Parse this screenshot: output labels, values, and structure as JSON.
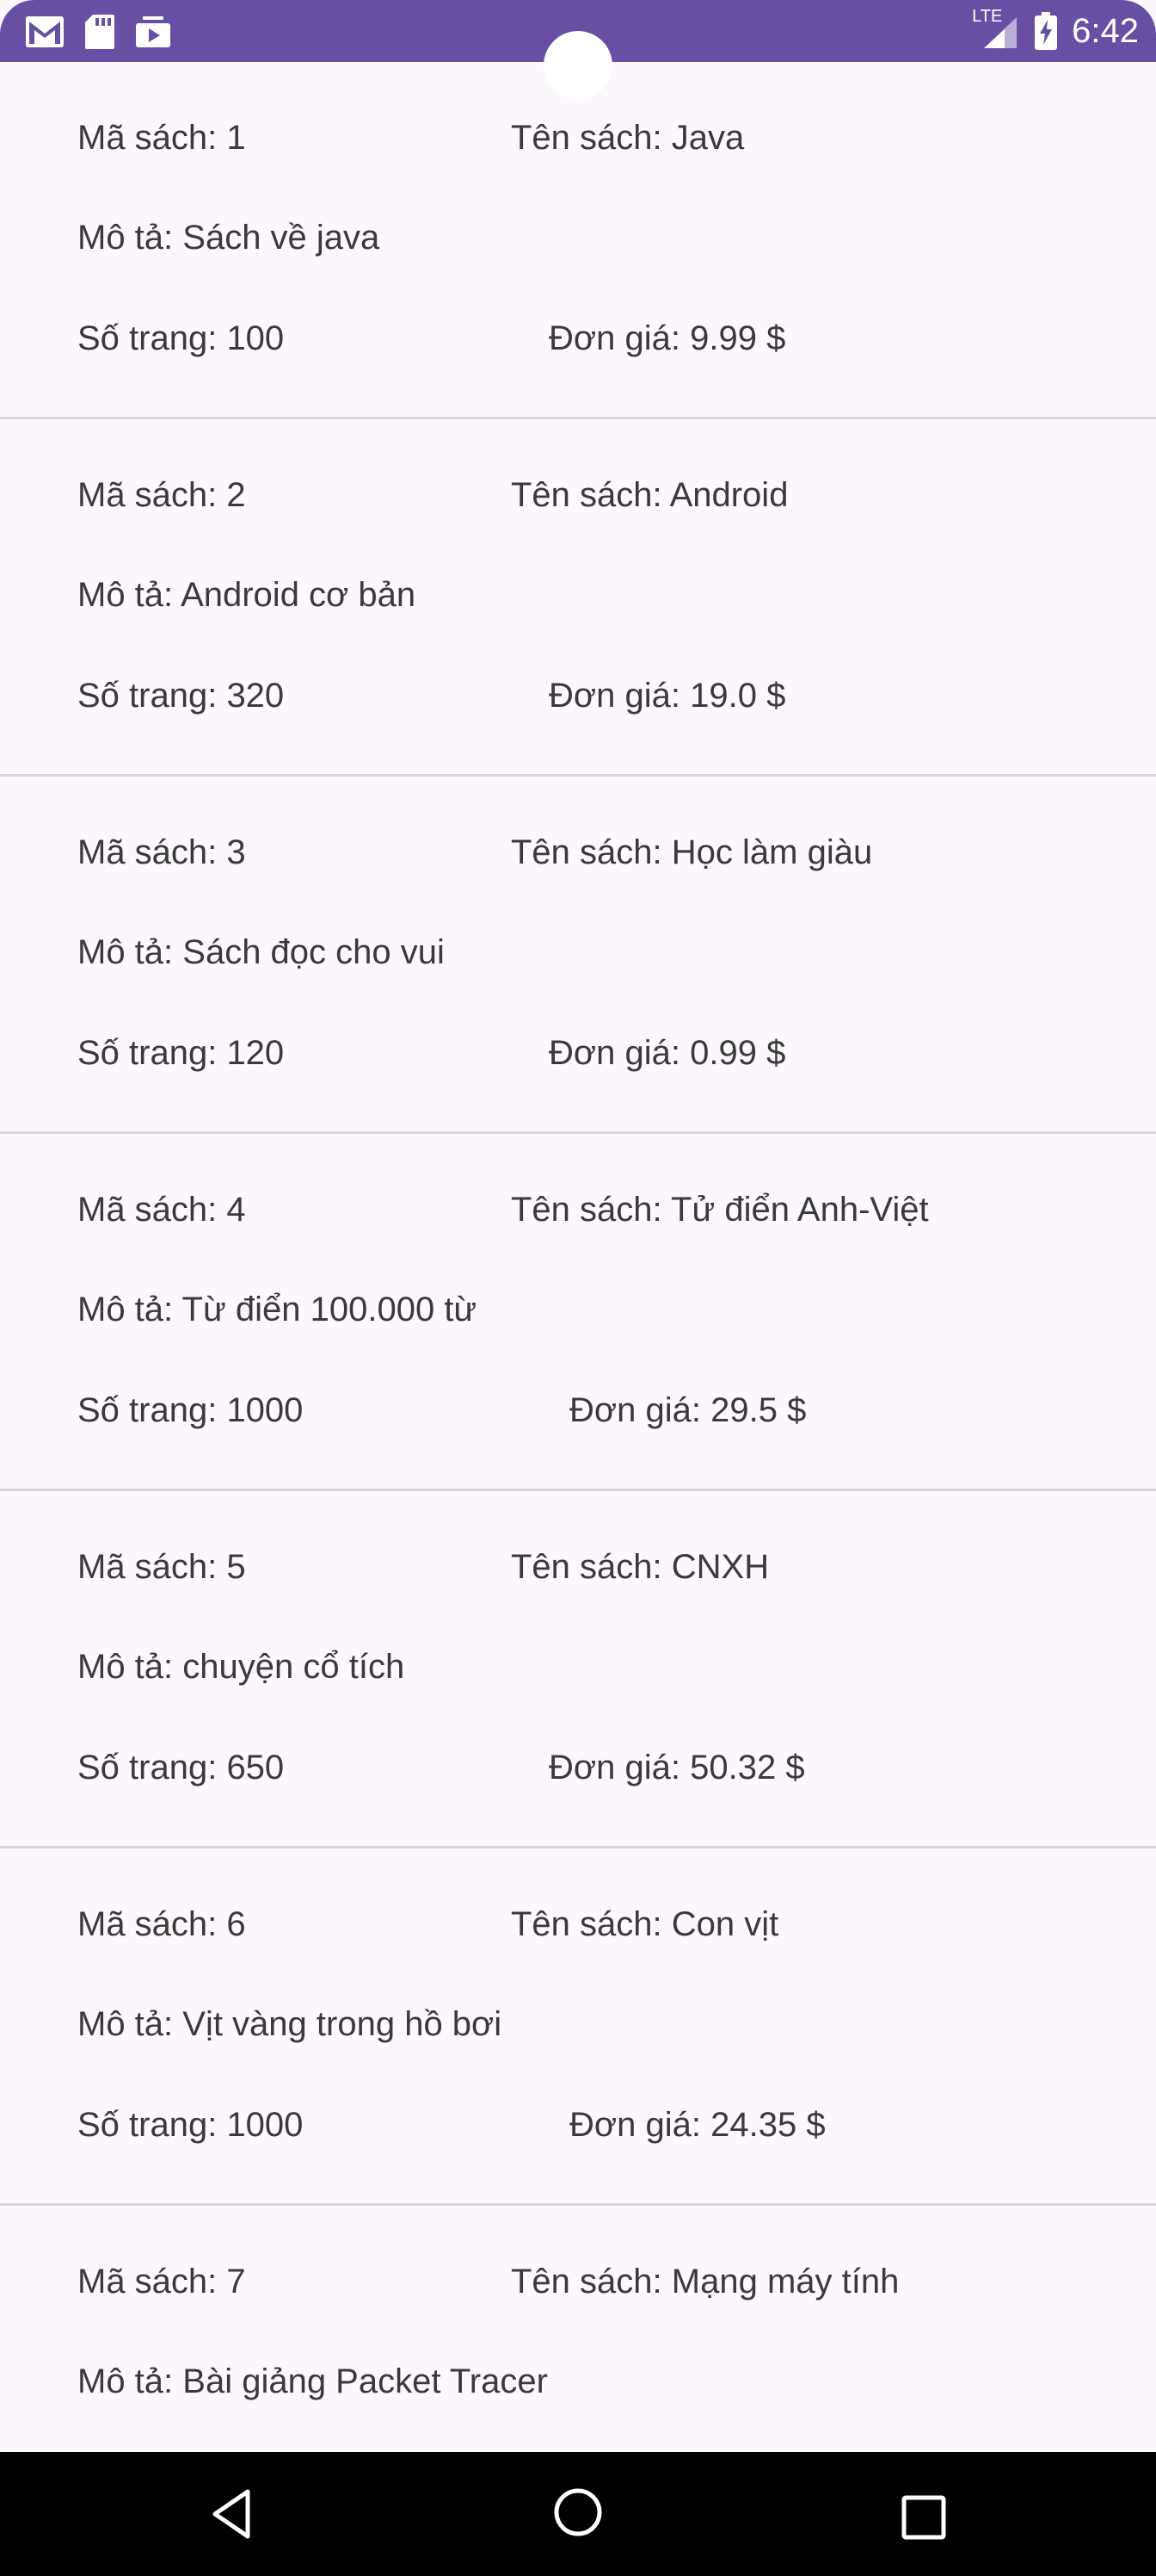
{
  "status_bar": {
    "time": "6:42",
    "network_label": "LTE",
    "left_icons": [
      "gmail-icon",
      "sd-card-icon",
      "media-icon"
    ],
    "background_color": "#6750a4"
  },
  "labels": {
    "id": "Mã sách: ",
    "name": "Tên sách: ",
    "description": "Mô tả: ",
    "pages": "Số trang: ",
    "price": "Đơn giá: ",
    "currency": " $"
  },
  "books": [
    {
      "id": "1",
      "name": "Java",
      "description": "Sách về java",
      "pages": "100",
      "price": "9.99"
    },
    {
      "id": "2",
      "name": "Android",
      "description": "Android cơ bản",
      "pages": "320",
      "price": "19.0"
    },
    {
      "id": "3",
      "name": "Học làm giàu",
      "description": "Sách đọc cho vui",
      "pages": "120",
      "price": "0.99"
    },
    {
      "id": "4",
      "name": "Tử điển Anh-Việt",
      "description": "Từ điển 100.000 từ",
      "pages": "1000",
      "price": "29.5"
    },
    {
      "id": "5",
      "name": "CNXH",
      "description": "chuyện cổ tích",
      "pages": "650",
      "price": "50.32"
    },
    {
      "id": "6",
      "name": "Con vịt",
      "description": "Vịt vàng trong hồ bơi",
      "pages": "1000",
      "price": "24.35"
    },
    {
      "id": "7",
      "name": "Mạng máy tính",
      "description": "Bài giảng Packet Tracer",
      "pages": "",
      "price": ""
    }
  ],
  "nav_bar": {
    "buttons": [
      "back-icon",
      "home-icon",
      "recents-icon"
    ]
  }
}
